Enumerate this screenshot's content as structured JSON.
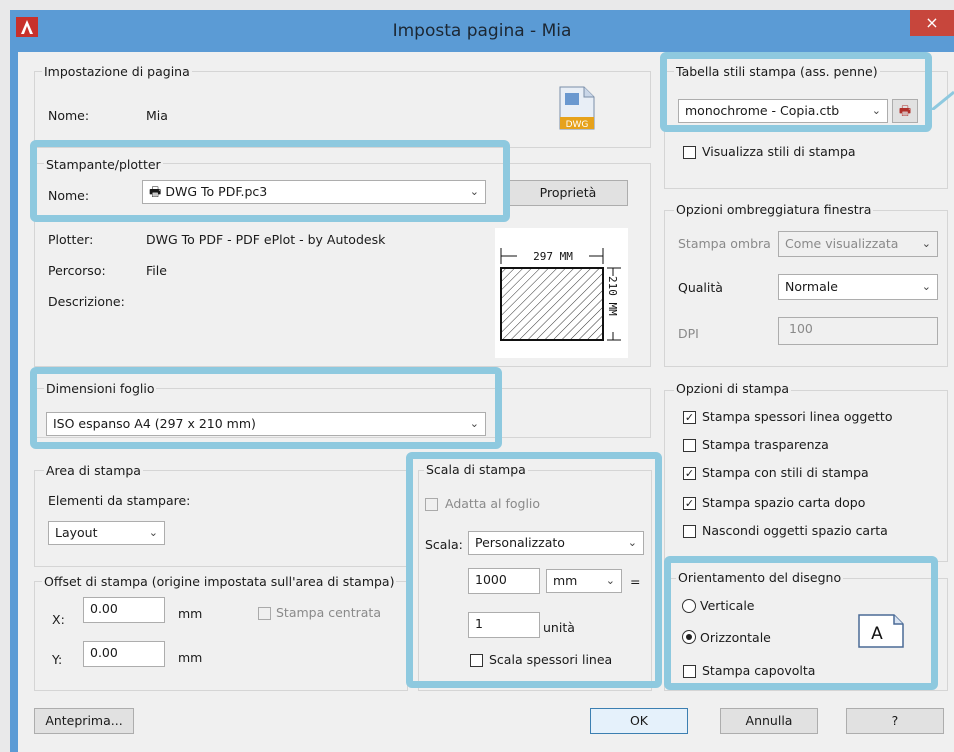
{
  "dialog": {
    "title": "Imposta pagina - Mia",
    "close_glyph": "×"
  },
  "page_setup": {
    "group_label": "Impostazione di pagina",
    "name_label": "Nome:",
    "name_value": "Mia",
    "dwg_icon_text": "DWG"
  },
  "plotter": {
    "group_label": "Stampante/plotter",
    "name_label": "Nome:",
    "printer_value": "DWG To PDF.pc3",
    "properties_button": "Proprietà",
    "plotter_label": "Plotter:",
    "plotter_value": "DWG To PDF - PDF ePlot - by Autodesk",
    "path_label": "Percorso:",
    "path_value": "File",
    "desc_label": "Descrizione:",
    "preview_width": "297  MM",
    "preview_height": "210 MM"
  },
  "paper_size": {
    "group_label": "Dimensioni foglio",
    "value": "ISO espanso A4 (297 x 210 mm)"
  },
  "plot_area": {
    "group_label": "Area di stampa",
    "what_label": "Elementi da stampare:",
    "what_value": "Layout"
  },
  "plot_offset": {
    "group_label": "Offset di stampa (origine impostata sull'area di stampa)",
    "x_label": "X:",
    "x_value": "0.00",
    "x_unit": "mm",
    "y_label": "Y:",
    "y_value": "0.00",
    "y_unit": "mm",
    "center_label": "Stampa centrata"
  },
  "plot_scale": {
    "group_label": "Scala di stampa",
    "fit_label": "Adatta al foglio",
    "scale_label": "Scala:",
    "scale_value": "Personalizzato",
    "value1": "1000",
    "unit_value": "mm",
    "equals": "=",
    "value2": "1",
    "units_label": "unità",
    "lineweights_label": "Scala spessori linea"
  },
  "style_table": {
    "group_label": "Tabella stili stampa (ass. penne)",
    "value": "monochrome - Copia.ctb",
    "display_label": "Visualizza stili di stampa"
  },
  "shaded": {
    "group_label": "Opzioni ombreggiatura finestra",
    "shade_label": "Stampa ombra",
    "shade_value": "Come visualizzata",
    "quality_label": "Qualità",
    "quality_value": "Normale",
    "dpi_label": "DPI",
    "dpi_value": "100"
  },
  "plot_options": {
    "group_label": "Opzioni di stampa",
    "items": [
      {
        "label": "Stampa spessori linea oggetto",
        "checked": "✓"
      },
      {
        "label": "Stampa trasparenza",
        "checked": ""
      },
      {
        "label": "Stampa con stili di stampa",
        "checked": "✓"
      },
      {
        "label": "Stampa spazio carta dopo",
        "checked": "✓"
      },
      {
        "label": "Nascondi oggetti spazio carta",
        "checked": ""
      }
    ]
  },
  "orientation": {
    "group_label": "Orientamento del disegno",
    "portrait_label": "Verticale",
    "landscape_label": "Orizzontale",
    "upside_label": "Stampa capovolta",
    "icon_letter": "A"
  },
  "footer": {
    "preview_button": "Anteprima...",
    "ok_button": "OK",
    "cancel_button": "Annulla",
    "help_button": "?"
  },
  "colors": {
    "title_bar": "#5b9bd5",
    "highlight": "#8ec9df",
    "close": "#c7463c"
  }
}
